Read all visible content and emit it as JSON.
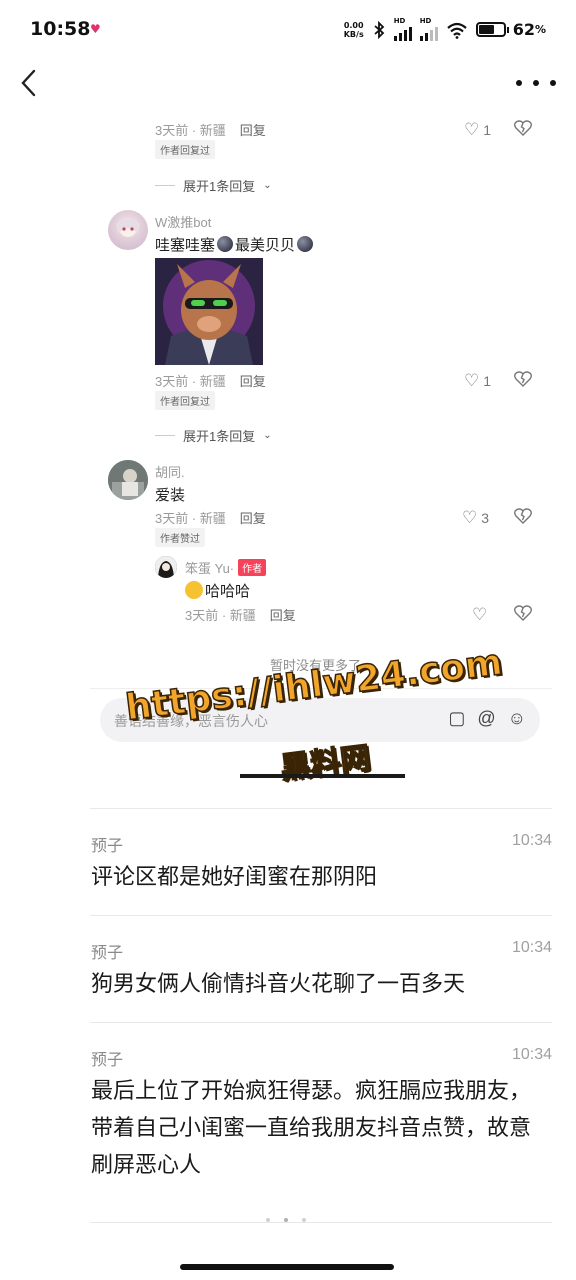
{
  "status_bar": {
    "time": "10:58",
    "net_speed_value": "0.00",
    "net_speed_unit": "KB/s",
    "hd1": "HD",
    "hd2": "HD",
    "battery": "62",
    "battery_level": 0.62
  },
  "embedded_comments": {
    "c1": {
      "meta_time": "3天前 · 新疆",
      "reply": "回复",
      "likes": "1",
      "tag": "作者回复过"
    },
    "expand1": "展开1条回复",
    "c2": {
      "nickname": "W激推bot",
      "text_a": "哇塞哇塞",
      "text_b": "最美贝贝",
      "meta_time": "3天前 · 新疆",
      "reply": "回复",
      "likes": "1",
      "tag": "作者回复过"
    },
    "expand2": "展开1条回复",
    "c3": {
      "nickname": "胡同.",
      "text": "爱装",
      "meta_time": "3天前 · 新疆",
      "reply": "回复",
      "likes": "3",
      "tag": "作者赞过"
    },
    "c4": {
      "nickname": "笨蛋 Yu·",
      "badge": "作者",
      "text": "哈哈哈",
      "meta_time": "3天前 · 新疆",
      "reply": "回复"
    },
    "no_more": "暂时没有更多了",
    "input_placeholder": "善语结善缘，恶言伤人心"
  },
  "watermark": {
    "url": "https://ihlw24.com",
    "name": "黑料网"
  },
  "messages": [
    {
      "name": "预子",
      "time": "10:34",
      "text": "评论区都是她好闺蜜在那阴阳"
    },
    {
      "name": "预子",
      "time": "10:34",
      "text": "狗男女俩人偷情抖音火花聊了一百多天"
    },
    {
      "name": "预子",
      "time": "10:34",
      "text": "最后上位了开始疯狂得瑟。疯狂膈应我朋友，带着自己小闺蜜一直给我朋友抖音点赞，故意刷屏恶心人"
    }
  ]
}
